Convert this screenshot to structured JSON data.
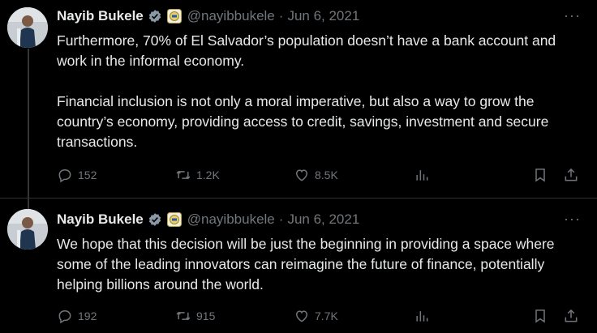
{
  "tweets": [
    {
      "author_name": "Nayib Bukele",
      "handle": "@nayibbukele",
      "separator": "·",
      "date": "Jun 6, 2021",
      "more": "···",
      "text": "Furthermore, 70% of El Salvador’s population doesn’t have a bank account and work in the informal economy.\n\nFinancial inclusion is not only a moral imperative, but also a way to grow the country’s economy, providing access to credit, savings, investment and secure transactions.",
      "replies": "152",
      "retweets": "1.2K",
      "likes": "8.5K"
    },
    {
      "author_name": "Nayib Bukele",
      "handle": "@nayibbukele",
      "separator": "·",
      "date": "Jun 6, 2021",
      "more": "···",
      "text": "We hope that this decision will be just the beginning in providing a space where some of the leading innovators can reimagine the future of finance, potentially helping billions around the world.",
      "replies": "192",
      "retweets": "915",
      "likes": "7.7K"
    }
  ],
  "colors": {
    "background": "#000000",
    "text_primary": "#e7e9ea",
    "text_secondary": "#71767b",
    "verified_blue": "#1d9bf0",
    "thread_line": "#333639"
  },
  "icons": [
    "verified-badge-icon",
    "affiliate-badge-icon",
    "more-icon",
    "reply-icon",
    "retweet-icon",
    "like-icon",
    "views-icon",
    "bookmark-icon",
    "share-icon"
  ]
}
